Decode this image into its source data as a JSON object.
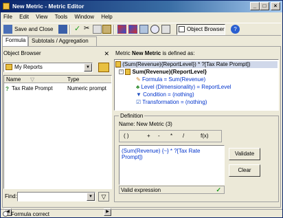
{
  "window": {
    "title": "New Metric - Metric Editor"
  },
  "menu": [
    "File",
    "Edit",
    "View",
    "Tools",
    "Window",
    "Help"
  ],
  "toolbar": {
    "save_close": "Save and Close",
    "object_browser": "Object Browser"
  },
  "tabs": [
    "Formula",
    "Subtotals / Aggregation"
  ],
  "object_browser": {
    "title": "Object Browser",
    "folder": "My Reports",
    "columns": [
      "Name",
      "Type"
    ],
    "items": [
      {
        "name": "Tax Rate Prompt",
        "type": "Numeric prompt"
      }
    ],
    "find_label": "Find:",
    "find_value": ""
  },
  "definition_caption": {
    "prefix": "Metric",
    "name": "New Metric",
    "suffix": "is defined as:"
  },
  "tree": {
    "root": "(Sum(Revenue){ReportLevel}) * ?[Tax Rate Prompt])",
    "child": "Sum(Revenue){ReportLevel}",
    "formula": "Formula = Sum(Revenue)",
    "level": "Level (Dimensionality) = ReportLevel",
    "condition": "Condition = (nothing)",
    "transformation": "Transformation = (nothing)"
  },
  "definition": {
    "legend": "Definition",
    "name_label": "Name:",
    "name_value": "New Metric (3)",
    "operators": [
      "( )",
      "+",
      "-",
      "*",
      "/",
      "f(x)"
    ],
    "expression": "(Sum(Revenue) {~} * ?[Tax Rate Prompt])",
    "status": "Valid expression",
    "validate": "Validate",
    "clear": "Clear"
  },
  "statusbar": {
    "text": "Formula correct"
  }
}
